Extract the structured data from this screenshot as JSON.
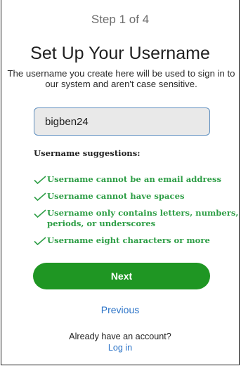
{
  "header": {
    "step_text": "Step 1 of 4",
    "title": "Set Up Your Username",
    "description": "The username you create here will be used to sign in to our system and aren't case sensitive."
  },
  "username_field": {
    "value": "bigben24"
  },
  "suggestions": {
    "title": "Username suggestions:",
    "check_color": "#2e9e46",
    "items": [
      {
        "label": "Username cannot be an email address",
        "icon": "check-icon"
      },
      {
        "label": "Username cannot have spaces",
        "icon": "check-icon"
      },
      {
        "label": "Username only contains letters, numbers, periods, or underscores",
        "icon": "check-icon"
      },
      {
        "label": "Username eight characters or more",
        "icon": "check-icon"
      }
    ]
  },
  "actions": {
    "next_label": "Next",
    "next_color": "#1f9623",
    "previous_label": "Previous"
  },
  "footer": {
    "account_text": "Already have an account?",
    "login_label": "Log in"
  }
}
